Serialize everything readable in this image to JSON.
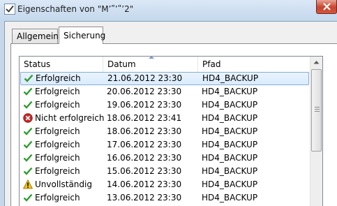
{
  "window": {
    "title": "Eigenschaften von \"M’ʺ’ʺ’2\"",
    "close_icon": "close-icon"
  },
  "tabs": [
    {
      "label": "Allgemein",
      "active": false
    },
    {
      "label": "Sicherung",
      "active": true
    }
  ],
  "table": {
    "columns": [
      "Status",
      "Datum",
      "Pfad"
    ],
    "sorted_column": "Datum",
    "rows": [
      {
        "status": "Erfolgreich",
        "icon": "success-check-icon",
        "datum": "21.06.2012 23:30",
        "pfad": "HD4_BACKUP",
        "selected": true
      },
      {
        "status": "Erfolgreich",
        "icon": "success-check-icon",
        "datum": "20.06.2012 23:30",
        "pfad": "HD4_BACKUP"
      },
      {
        "status": "Erfolgreich",
        "icon": "success-check-icon",
        "datum": "19.06.2012 23:30",
        "pfad": "HD4_BACKUP"
      },
      {
        "status": "Nicht erfolgreich",
        "icon": "error-x-icon",
        "datum": "18.06.2012 23:41",
        "pfad": "HD4_BACKUP"
      },
      {
        "status": "Erfolgreich",
        "icon": "success-check-icon",
        "datum": "18.06.2012 23:30",
        "pfad": "HD4_BACKUP"
      },
      {
        "status": "Erfolgreich",
        "icon": "success-check-icon",
        "datum": "17.06.2012 23:30",
        "pfad": "HD4_BACKUP"
      },
      {
        "status": "Erfolgreich",
        "icon": "success-check-icon",
        "datum": "16.06.2012 23:30",
        "pfad": "HD4_BACKUP"
      },
      {
        "status": "Erfolgreich",
        "icon": "success-check-icon",
        "datum": "15.06.2012 23:30",
        "pfad": "HD4_BACKUP"
      },
      {
        "status": "Unvollständig",
        "icon": "warning-triangle-icon",
        "datum": "14.06.2012 23:30",
        "pfad": "HD4_BACKUP"
      },
      {
        "status": "Erfolgreich",
        "icon": "success-check-icon",
        "datum": "13.06.2012 23:30",
        "pfad": "HD4_BACKUP"
      }
    ]
  },
  "colors": {
    "success": "#2e9d2e",
    "error": "#c62828",
    "warning": "#f2c40f",
    "selection": "#d9ebfd"
  }
}
